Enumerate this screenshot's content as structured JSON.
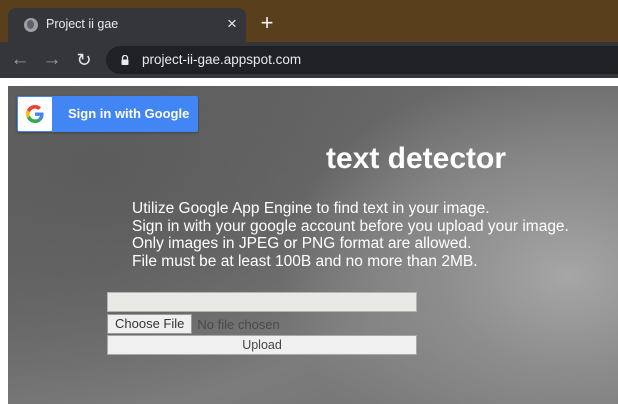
{
  "browser": {
    "tab_title": "Project ii gae",
    "tab_close": "×",
    "new_tab": "+",
    "url": "project-ii-gae.appspot.com",
    "nav": {
      "back": "←",
      "forward": "→",
      "reload": "↻"
    }
  },
  "page": {
    "sign_in_label": "Sign in with Google",
    "title": "text detector",
    "description": [
      "Utilize Google App Engine to find text in your image.",
      "Sign in with your google account before you upload your image.",
      "Only images in JPEG or PNG format are allowed.",
      "File must be at least 100B and no more than 2MB."
    ],
    "file_text_value": "",
    "choose_file_label": "Choose File",
    "no_file_label": "No file chosen",
    "upload_label": "Upload"
  },
  "icons": {
    "favicon": "globe-icon",
    "lock": "lock-icon",
    "google": "google-g-icon"
  },
  "colors": {
    "google_blue": "#4285f4",
    "tabstrip": "#5a3f1d",
    "chrome_dark": "#35363a"
  }
}
